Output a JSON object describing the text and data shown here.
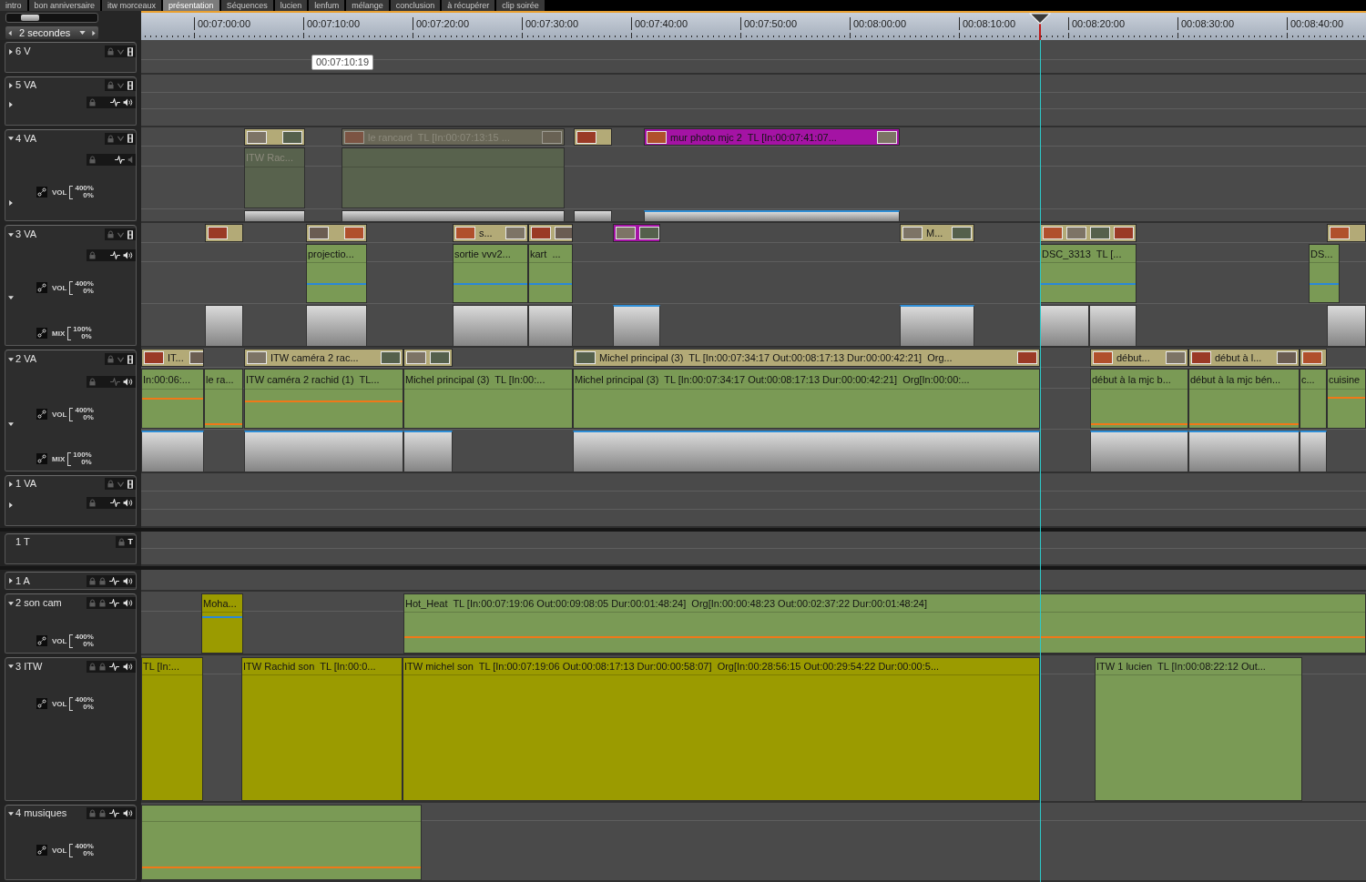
{
  "sequence_tabs": [
    {
      "label": "intro",
      "selected": false
    },
    {
      "label": "bon anniversaire",
      "selected": false
    },
    {
      "label": "itw morceaux",
      "selected": false
    },
    {
      "label": "présentation",
      "selected": true
    },
    {
      "label": "Séquences",
      "selected": false
    },
    {
      "label": "lucien",
      "selected": false
    },
    {
      "label": "lenfum",
      "selected": false
    },
    {
      "label": "mélange",
      "selected": false
    },
    {
      "label": "conclusion",
      "selected": false
    },
    {
      "label": "à récupérer",
      "selected": false
    },
    {
      "label": "clip soirée",
      "selected": false
    }
  ],
  "zoom_slider": {
    "level": 0.2
  },
  "time_scale": {
    "label": "2 secondes"
  },
  "ruler": {
    "ticks": [
      "00:07:00:00",
      "00:07:10:00",
      "00:07:20:00",
      "00:07:30:00",
      "00:07:40:00",
      "00:07:50:00",
      "00:08:00:00",
      "00:08:10:00",
      "00:08:20:00",
      "00:08:30:00",
      "00:08:40:00"
    ]
  },
  "hover_tooltip": "00:07:10:19",
  "tracks": [
    {
      "name": "6 V",
      "kind": "v",
      "expanded": false
    },
    {
      "name": "5 VA",
      "kind": "va",
      "expanded": false,
      "mix_expanded": false,
      "waveform_on": true,
      "speaker_on": true
    },
    {
      "name": "4 VA",
      "kind": "va",
      "expanded": true,
      "mix_expanded": false,
      "waveform_on": true,
      "speaker_on": false,
      "bands": [
        {
          "label": "VOL",
          "max": "400%",
          "min": "0%"
        }
      ],
      "video_clips": [
        {
          "color": "#b3aa77",
          "disabled": false
        },
        {
          "title": "le rancard  TL [In:00:07:13:15 ...",
          "disabled": true
        },
        {
          "color": "#b3aa77",
          "disabled": false
        },
        {
          "title": "mur photo mjc 2  TL [In:00:07:41:07...",
          "color": "#a413a4",
          "disabled": false
        }
      ],
      "audio_clips": [
        {
          "label": "ITW Rac...",
          "disabled": true
        },
        {
          "disabled": true
        }
      ]
    },
    {
      "name": "3 VA",
      "kind": "va",
      "expanded": true,
      "mix_expanded": true,
      "waveform_on": true,
      "speaker_on": true,
      "bands": [
        {
          "label": "VOL",
          "max": "400%",
          "min": "0%"
        },
        {
          "label": "MIX",
          "max": "100%",
          "min": "0%"
        }
      ],
      "video_clips": [
        {
          "color": "#b3aa77"
        },
        {
          "color": "#b3aa77"
        },
        {
          "title": "s...",
          "color": "#b3aa77"
        },
        {
          "color": "#b3aa77"
        },
        {
          "color": "#a413a4"
        },
        {
          "title": "M...",
          "color": "#b3aa77"
        },
        {
          "color": "#b3aa77"
        },
        {
          "color": "#b3aa77"
        }
      ],
      "audio_clips": [
        {
          "label": "projectio...",
          "color": "#7a9a55"
        },
        {
          "label": "sortie vvv2...",
          "color": "#7a9a55"
        },
        {
          "label": "kart  ...",
          "color": "#7a9a55"
        },
        {
          "label": "DSC_3313  TL [...",
          "color": "#7a9a55"
        },
        {
          "label": "DS...",
          "color": "#7a9a55"
        }
      ]
    },
    {
      "name": "2 VA",
      "kind": "va",
      "expanded": true,
      "mix_expanded": true,
      "waveform_on": false,
      "speaker_on": true,
      "bands": [
        {
          "label": "VOL",
          "max": "400%",
          "min": "0%"
        },
        {
          "label": "MIX",
          "max": "100%",
          "min": "0%"
        }
      ],
      "video_clips": [
        {
          "title": "IT...",
          "color": "#b3aa77"
        },
        {
          "title": "ITW caméra 2 rac...",
          "color": "#b3aa77"
        },
        {
          "color": "#b3aa77"
        },
        {
          "title": "Michel principal (3)  TL [In:00:07:34:17 Out:00:08:17:13 Dur:00:00:42:21]  Org...",
          "color": "#b3aa77"
        },
        {
          "title": "début...",
          "color": "#b3aa77"
        },
        {
          "title": "début à l...",
          "color": "#b3aa77"
        },
        {
          "color": "#b3aa77"
        }
      ],
      "audio_clips": [
        {
          "label": "In:00:06:...",
          "color": "#7a9a55"
        },
        {
          "label": "le ra...",
          "color": "#7a9a55"
        },
        {
          "label": "ITW caméra 2 rachid (1)  TL...",
          "color": "#7a9a55"
        },
        {
          "label": "Michel principal (3)  TL [In:00:...",
          "color": "#7a9a55"
        },
        {
          "label": "Michel principal (3)  TL [In:00:07:34:17 Out:00:08:17:13 Dur:00:00:42:21]  Org[In:00:00:...",
          "color": "#7a9a55"
        },
        {
          "label": "début à la mjc b...",
          "color": "#7a9a55"
        },
        {
          "label": "début à la mjc bén...",
          "color": "#7a9a55"
        },
        {
          "label": "c...",
          "color": "#7a9a55"
        },
        {
          "label": "cuisine",
          "color": "#7a9a55"
        }
      ]
    },
    {
      "name": "1 VA",
      "kind": "va",
      "expanded": false,
      "mix_expanded": false,
      "waveform_on": true,
      "speaker_on": true
    },
    {
      "name": "1 T",
      "kind": "t",
      "badge": "T"
    },
    {
      "name": "1 A",
      "kind": "a",
      "expanded": false,
      "waveform_on": true,
      "speaker_on": true
    },
    {
      "name": "2 son cam",
      "kind": "a",
      "expanded": true,
      "waveform_on": true,
      "speaker_on": true,
      "bands": [
        {
          "label": "VOL",
          "max": "400%",
          "min": "0%"
        }
      ],
      "clips": [
        {
          "label": "Moha...",
          "color": "#9b9b00"
        },
        {
          "label": "Hot_Heat  TL [In:00:07:19:06 Out:00:09:08:05 Dur:00:01:48:24]  Org[In:00:00:48:23 Out:00:02:37:22 Dur:00:01:48:24]",
          "color": "#7a9a55"
        }
      ]
    },
    {
      "name": "3 ITW",
      "kind": "a",
      "expanded": true,
      "waveform_on": true,
      "speaker_on": true,
      "bands": [
        {
          "label": "VOL",
          "max": "400%",
          "min": "0%"
        }
      ],
      "clips": [
        {
          "label": "TL [In:...",
          "color": "#9b9b00"
        },
        {
          "label": "ITW Rachid son  TL [In:00:0...",
          "color": "#9b9b00"
        },
        {
          "label": "ITW michel son  TL [In:00:07:19:06 Out:00:08:17:13 Dur:00:00:58:07]  Org[In:00:28:56:15 Out:00:29:54:22 Dur:00:00:5...",
          "color": "#9b9b00"
        },
        {
          "label": "ITW 1 lucien  TL [In:00:08:22:12 Out...",
          "color": "#7a9a55"
        }
      ]
    },
    {
      "name": "4 musiques",
      "kind": "a",
      "expanded": true,
      "waveform_on": true,
      "speaker_on": true,
      "bands": [
        {
          "label": "VOL",
          "max": "400%",
          "min": "0%"
        }
      ],
      "clips": [
        {
          "color": "#7a9a55"
        }
      ]
    }
  ]
}
